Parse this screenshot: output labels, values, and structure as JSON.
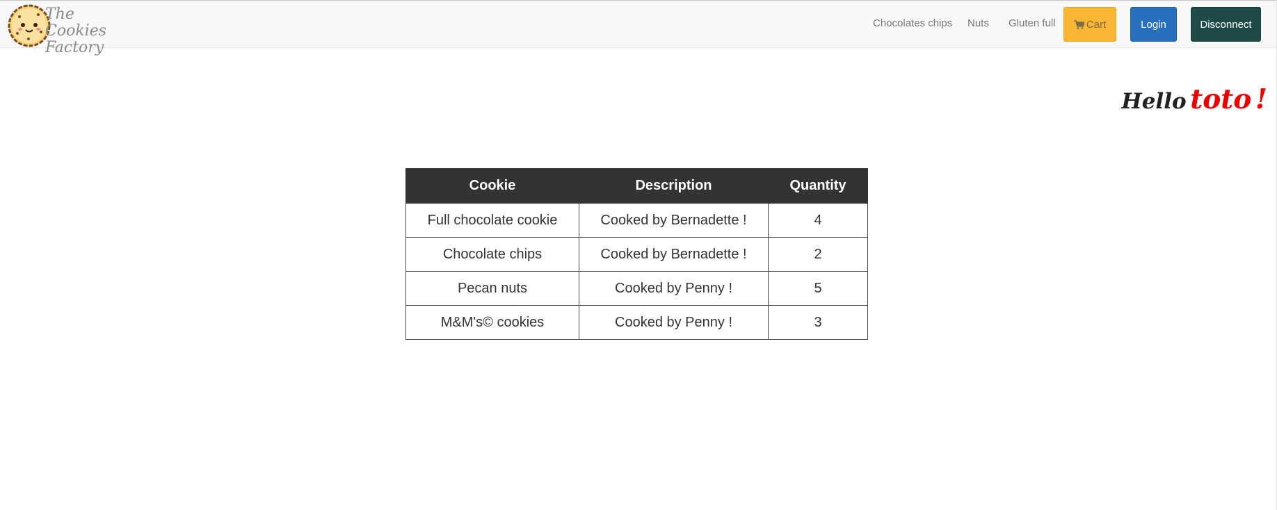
{
  "brand": {
    "line1": "The Cookies",
    "line2": "Factory"
  },
  "nav": {
    "links": [
      "Chocolates chips",
      "Nuts",
      "Gluten full"
    ],
    "cart_label": "Cart",
    "login_label": "Login",
    "disconnect_label": "Disconnect"
  },
  "greeting": {
    "hello": "Hello",
    "user": "toto",
    "punct": "!"
  },
  "table": {
    "headers": [
      "Cookie",
      "Description",
      "Quantity"
    ],
    "rows": [
      [
        "Full chocolate cookie",
        "Cooked by Bernadette !",
        "4"
      ],
      [
        "Chocolate chips",
        "Cooked by Bernadette !",
        "2"
      ],
      [
        "Pecan nuts",
        "Cooked by Penny !",
        "5"
      ],
      [
        "M&M's© cookies",
        "Cooked by Penny !",
        "3"
      ]
    ]
  },
  "colors": {
    "navbar_bg": "#f8f8f8",
    "cart_button": "#f9b634",
    "login_button": "#2670be",
    "disconnect_button": "#1e4a48",
    "table_header": "#333333",
    "greeting_user": "#ee0000"
  },
  "icons": {
    "logo": "cookie-face-icon",
    "cart": "shopping-cart-icon"
  }
}
